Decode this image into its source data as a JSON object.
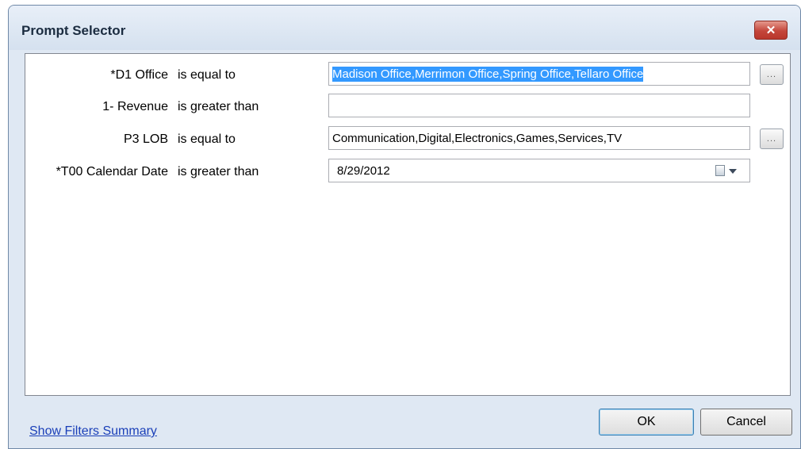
{
  "window": {
    "title": "Prompt Selector",
    "close_glyph": "✕"
  },
  "prompts": [
    {
      "name": "*D1  Office",
      "operator": "is equal to",
      "value": "Madison Office,Merrimon Office,Spring Office,Tellaro Office",
      "browse": "..."
    },
    {
      "name": "1- Revenue",
      "operator": "is greater than",
      "value": ""
    },
    {
      "name": "P3  LOB",
      "operator": "is equal to",
      "value": "Communication,Digital,Electronics,Games,Services,TV",
      "browse": "..."
    },
    {
      "name": "*T00 Calendar Date",
      "operator": "is greater than",
      "value": "8/29/2012"
    }
  ],
  "footer": {
    "link": "Show Filters Summary",
    "ok": "OK",
    "cancel": "Cancel"
  },
  "icons": {
    "browse": "ellipsis-icon",
    "date": "calendar-dropdown-icon"
  },
  "colors": {
    "selection": "#3399ff",
    "link": "#1a3fb8",
    "close": "#c4463b"
  }
}
